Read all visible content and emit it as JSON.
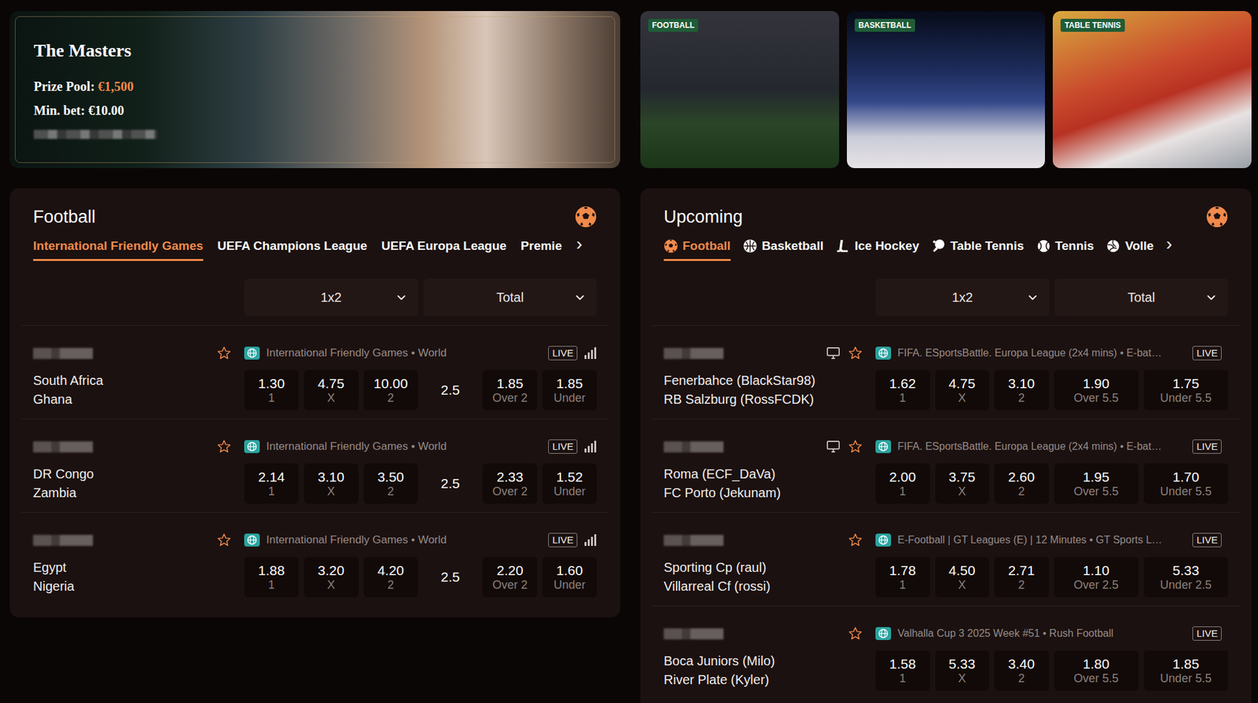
{
  "banner": {
    "title": "The Masters",
    "prize_label": "Prize Pool:",
    "prize_value": "€1,500",
    "min_bet": "Min. bet: €10.00"
  },
  "media_tiles": [
    {
      "badge": "FOOTBALL"
    },
    {
      "badge": "BASKETBALL"
    },
    {
      "badge": "TABLE TENNIS"
    }
  ],
  "football_panel": {
    "title": "Football",
    "tabs": [
      {
        "label": "International Friendly Games",
        "selected": true
      },
      {
        "label": "UEFA Champions League",
        "selected": false
      },
      {
        "label": "UEFA Europa League",
        "selected": false
      },
      {
        "label": "Premie",
        "selected": false
      }
    ],
    "more": "›",
    "markets": [
      {
        "label": "1x2",
        "expanded": false
      },
      {
        "label": "Total",
        "expanded": false
      }
    ],
    "rows": [
      {
        "league": "International Friendly Games • World",
        "live": "LIVE",
        "favorite": false,
        "stream": false,
        "stats": true,
        "home": "South Africa",
        "away": "Ghana",
        "odds": [
          {
            "value": "1.30",
            "label": "1"
          },
          {
            "value": "4.75",
            "label": "X"
          },
          {
            "value": "10.00",
            "label": "2"
          }
        ],
        "total": "2.5",
        "over": {
          "value": "1.85",
          "label": "Over 2"
        },
        "under": {
          "value": "1.85",
          "label": "Under"
        }
      },
      {
        "league": "International Friendly Games • World",
        "live": "LIVE",
        "favorite": false,
        "stream": false,
        "stats": true,
        "home": "DR Congo",
        "away": "Zambia",
        "odds": [
          {
            "value": "2.14",
            "label": "1"
          },
          {
            "value": "3.10",
            "label": "X"
          },
          {
            "value": "3.50",
            "label": "2"
          }
        ],
        "total": "2.5",
        "over": {
          "value": "2.33",
          "label": "Over 2"
        },
        "under": {
          "value": "1.52",
          "label": "Under"
        }
      },
      {
        "league": "International Friendly Games • World",
        "live": "LIVE",
        "favorite": false,
        "stream": false,
        "stats": true,
        "home": "Egypt",
        "away": "Nigeria",
        "odds": [
          {
            "value": "1.88",
            "label": "1"
          },
          {
            "value": "3.20",
            "label": "X"
          },
          {
            "value": "4.20",
            "label": "2"
          }
        ],
        "total": "2.5",
        "over": {
          "value": "2.20",
          "label": "Over 2"
        },
        "under": {
          "value": "1.60",
          "label": "Under"
        }
      }
    ]
  },
  "upcoming_panel": {
    "title": "Upcoming",
    "tabs": [
      {
        "label": "Football",
        "selected": true
      },
      {
        "label": "Basketball",
        "selected": false
      },
      {
        "label": "Ice Hockey",
        "selected": false
      },
      {
        "label": "Table Tennis",
        "selected": false
      },
      {
        "label": "Tennis",
        "selected": false
      },
      {
        "label": "Volle",
        "selected": false
      }
    ],
    "more": "›",
    "markets": [
      {
        "label": "1x2",
        "expanded": false
      },
      {
        "label": "Total",
        "expanded": false
      }
    ],
    "rows": [
      {
        "league": "FIFA. ESportsBattle. Europa League (2x4 mins) • E-bat…",
        "live": "LIVE",
        "favorite": false,
        "stream": true,
        "stats": false,
        "home": "Fenerbahce (BlackStar98)",
        "away": "RB Salzburg (RossFCDK)",
        "odds": [
          {
            "value": "1.62",
            "label": "1"
          },
          {
            "value": "4.75",
            "label": "X"
          },
          {
            "value": "3.10",
            "label": "2"
          }
        ],
        "over": {
          "value": "1.90",
          "label": "Over 5.5"
        },
        "under": {
          "value": "1.75",
          "label": "Under 5.5"
        }
      },
      {
        "league": "FIFA. ESportsBattle. Europa League (2x4 mins) • E-bat…",
        "live": "LIVE",
        "favorite": false,
        "stream": true,
        "stats": false,
        "home": "Roma (ECF_DaVa)",
        "away": "FC Porto (Jekunam)",
        "odds": [
          {
            "value": "2.00",
            "label": "1"
          },
          {
            "value": "3.75",
            "label": "X"
          },
          {
            "value": "2.60",
            "label": "2"
          }
        ],
        "over": {
          "value": "1.95",
          "label": "Over 5.5"
        },
        "under": {
          "value": "1.70",
          "label": "Under 5.5"
        }
      },
      {
        "league": "E-Football | GT Leagues (E) | 12 Minutes • GT Sports L…",
        "live": "LIVE",
        "favorite": false,
        "stream": false,
        "stats": false,
        "home": "Sporting Cp (raul)",
        "away": "Villarreal Cf (rossi)",
        "odds": [
          {
            "value": "1.78",
            "label": "1"
          },
          {
            "value": "4.50",
            "label": "X"
          },
          {
            "value": "2.71",
            "label": "2"
          }
        ],
        "over": {
          "value": "1.10",
          "label": "Over 2.5"
        },
        "under": {
          "value": "5.33",
          "label": "Under 2.5"
        }
      },
      {
        "league": "Valhalla Cup 3 2025 Week #51 • Rush Football",
        "live": "LIVE",
        "favorite": false,
        "stream": false,
        "stats": false,
        "home": "Boca Juniors (Milo)",
        "away": "River Plate (Kyler)",
        "odds": [
          {
            "value": "1.58",
            "label": "1"
          },
          {
            "value": "5.33",
            "label": "X"
          },
          {
            "value": "3.40",
            "label": "2"
          }
        ],
        "over": {
          "value": "1.80",
          "label": "Over 5.5"
        },
        "under": {
          "value": "1.85",
          "label": "Under 5.5"
        }
      }
    ]
  }
}
